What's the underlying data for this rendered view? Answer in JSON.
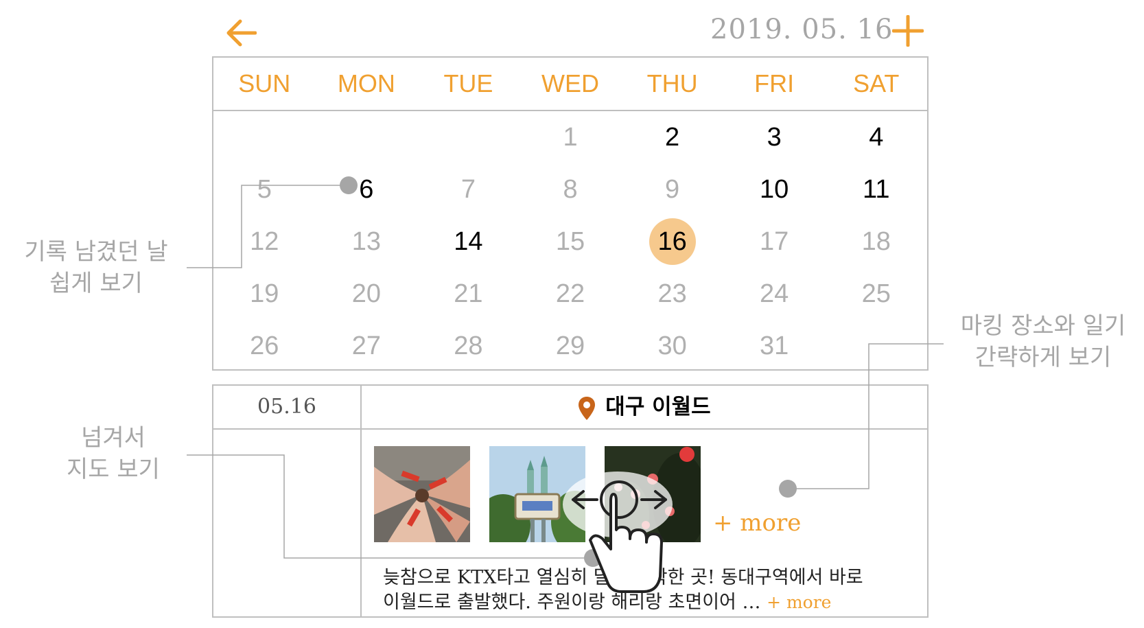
{
  "header": {
    "back_icon": "arrow-left-icon",
    "date": "2019. 05. 16",
    "add_icon": "plus-icon",
    "accent_color": "#f0a030"
  },
  "calendar": {
    "weekdays": [
      "SUN",
      "MON",
      "TUE",
      "WED",
      "THU",
      "FRI",
      "SAT"
    ],
    "weeks": [
      [
        {
          "d": "",
          "rec": false
        },
        {
          "d": "",
          "rec": false
        },
        {
          "d": "",
          "rec": false
        },
        {
          "d": "1",
          "rec": false
        },
        {
          "d": "2",
          "rec": true
        },
        {
          "d": "3",
          "rec": true
        },
        {
          "d": "4",
          "rec": true
        }
      ],
      [
        {
          "d": "5",
          "rec": false
        },
        {
          "d": "6",
          "rec": true
        },
        {
          "d": "7",
          "rec": false
        },
        {
          "d": "8",
          "rec": false
        },
        {
          "d": "9",
          "rec": false
        },
        {
          "d": "10",
          "rec": true
        },
        {
          "d": "11",
          "rec": true
        }
      ],
      [
        {
          "d": "12",
          "rec": false
        },
        {
          "d": "13",
          "rec": false
        },
        {
          "d": "14",
          "rec": true
        },
        {
          "d": "15",
          "rec": false
        },
        {
          "d": "16",
          "rec": true,
          "today": true
        },
        {
          "d": "17",
          "rec": false
        },
        {
          "d": "18",
          "rec": false
        }
      ],
      [
        {
          "d": "19",
          "rec": false
        },
        {
          "d": "20",
          "rec": false
        },
        {
          "d": "21",
          "rec": false
        },
        {
          "d": "22",
          "rec": false
        },
        {
          "d": "23",
          "rec": false
        },
        {
          "d": "24",
          "rec": false
        },
        {
          "d": "25",
          "rec": false
        }
      ],
      [
        {
          "d": "26",
          "rec": false
        },
        {
          "d": "27",
          "rec": false
        },
        {
          "d": "28",
          "rec": false
        },
        {
          "d": "29",
          "rec": false
        },
        {
          "d": "30",
          "rec": false
        },
        {
          "d": "31",
          "rec": false
        },
        {
          "d": "",
          "rec": false
        }
      ]
    ],
    "today_color": "#f6c98d"
  },
  "detail": {
    "date": "05.16",
    "place_icon": "map-pin-icon",
    "place": "대구 이월드",
    "photos": [
      "friends-wristbands-photo",
      "eworld-entrance-photo",
      "lantern-night-photo"
    ],
    "more_photos": "+ more",
    "diary_line1": "늦참으로 KTX타고 열심히 달려 도착한 곳! 동대구역에서 바로",
    "diary_line2": "이월드로 출발했다. 주원이랑 해리랑 초면이어 …",
    "diary_more": "+ more"
  },
  "annotations": {
    "note1_line1": "기록 남겼던 날",
    "note1_line2": "쉽게 보기",
    "note2_line1": "마킹 장소와 일기",
    "note2_line2": "간략하게 보기",
    "note3_line1": "넘겨서",
    "note3_line2": "지도 보기",
    "swipe_icon": "swipe-hand-icon"
  }
}
